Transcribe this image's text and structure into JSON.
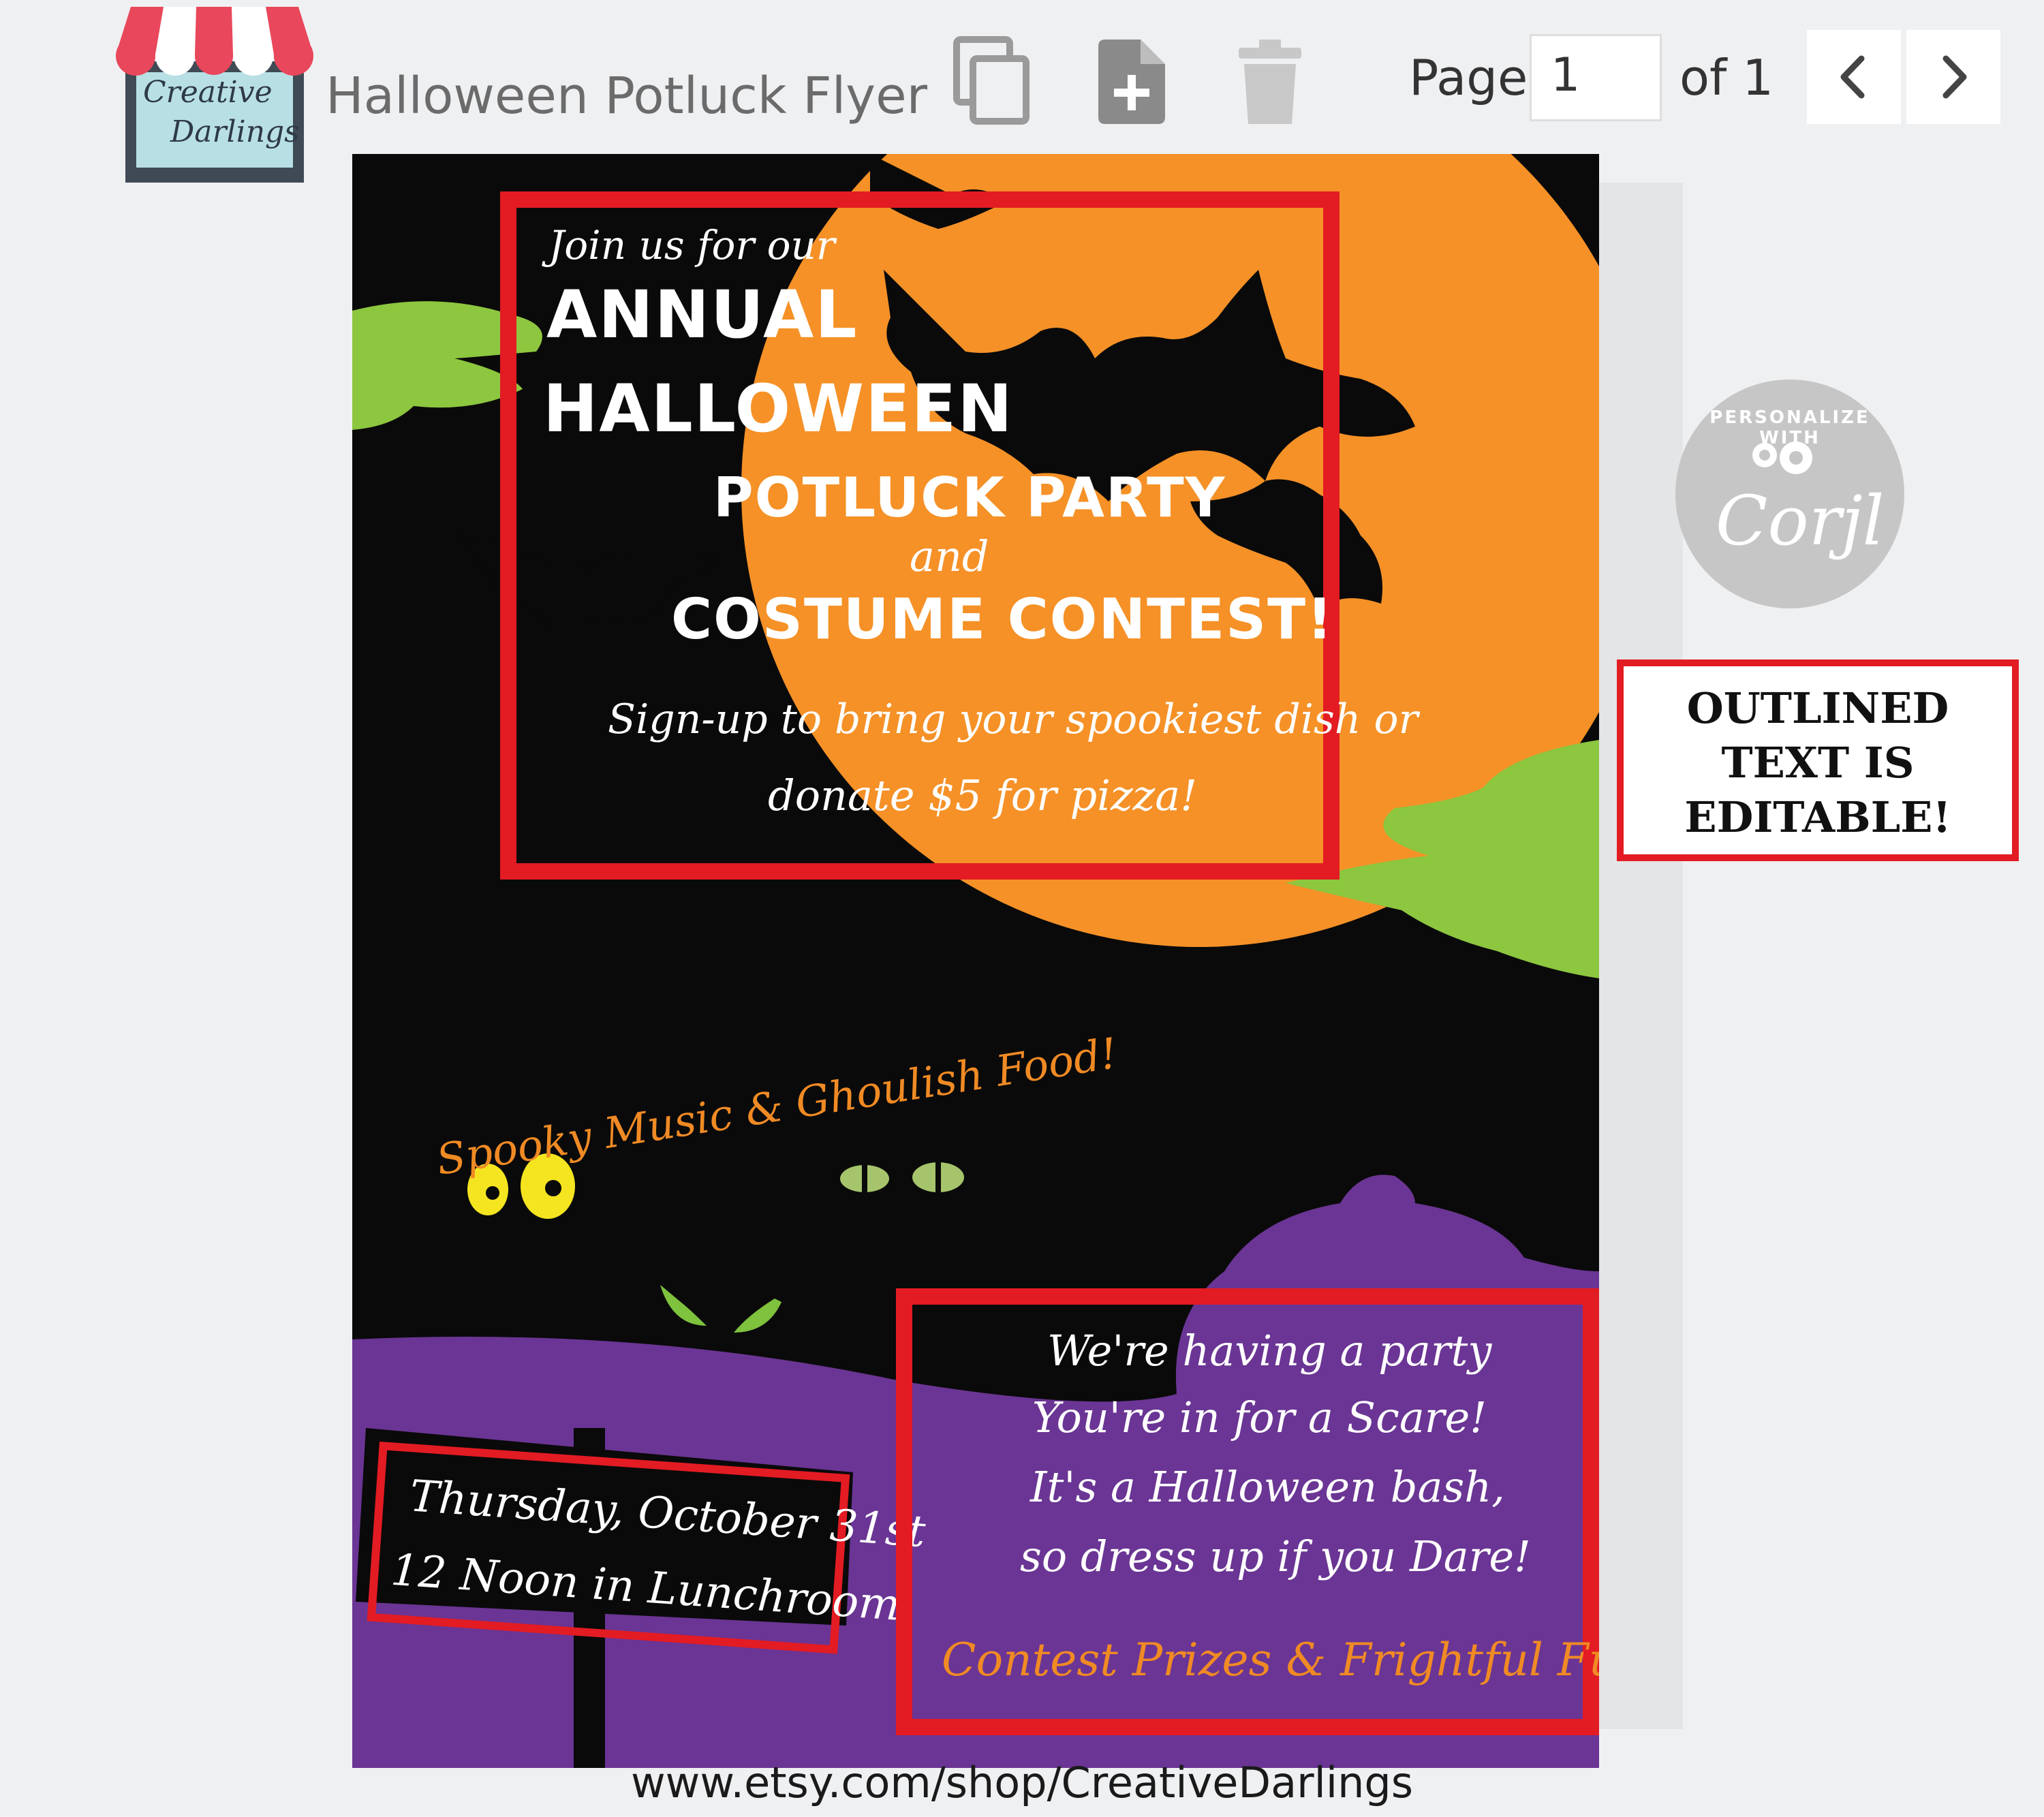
{
  "header": {
    "logo_line1": "Creative",
    "logo_line2": "Darlings",
    "doc_title": "Halloween Potluck Flyer",
    "icons": [
      "copy-icon",
      "add-page-icon",
      "trash-icon"
    ],
    "page_label": "Page",
    "page_value": "1",
    "of_label": "of 1",
    "prev_icon": "chevron-left-icon",
    "next_icon": "chevron-right-icon"
  },
  "flyer": {
    "intro": "Join us for our",
    "title_line1": "ANNUAL",
    "title_line2": "HALLOWEEN",
    "title_line3": "POTLUCK PARTY",
    "title_and": "and",
    "title_line4": "COSTUME CONTEST!",
    "signup_line1": "Sign-up to bring your spookiest dish or",
    "signup_line2": "donate $5 for pizza!",
    "spooky": "Spooky Music & Ghoulish Food!",
    "sign_line1": "Thursday, October 31st",
    "sign_line2": "12 Noon in Lunchroom",
    "poem_line1": "We're having a party",
    "poem_line2": "You're in for a Scare!",
    "poem_line3": "It's a Halloween bash,",
    "poem_line4": "so dress up if you Dare!",
    "prizes": "Contest Prizes & Frightful Fun!"
  },
  "badge": {
    "top": "PERSONALIZE WITH",
    "brand": "Corjl"
  },
  "note": {
    "line1": "OUTLINED",
    "line2": "TEXT IS",
    "line3": "EDITABLE!"
  },
  "footer": {
    "url": "www.etsy.com/shop/CreativeDarlings"
  },
  "colors": {
    "moon": "#f59127",
    "slime": "#8dc63f",
    "purple": "#6a3594",
    "red_outline": "#e31b23",
    "orange_text": "#f08a24"
  }
}
